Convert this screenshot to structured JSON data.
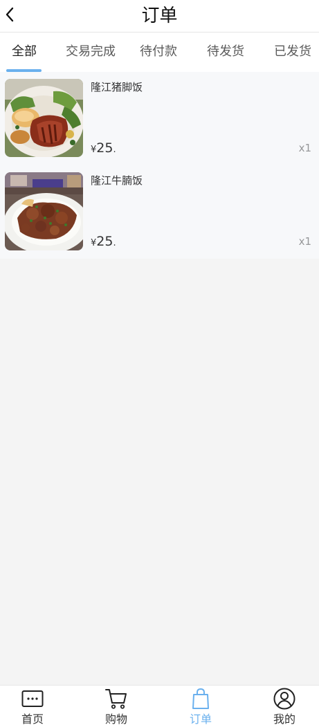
{
  "header": {
    "title": "订单"
  },
  "tabs": [
    {
      "label": "全部",
      "active": true
    },
    {
      "label": "交易完成",
      "active": false
    },
    {
      "label": "待付款",
      "active": false
    },
    {
      "label": "待发货",
      "active": false
    },
    {
      "label": "已发货",
      "active": false
    }
  ],
  "orders": [
    {
      "name": "隆江猪脚饭",
      "currency": "¥",
      "price": "25",
      "price_suffix": ".",
      "quantity": "x1",
      "image": "pork-knuckle-rice-photo"
    },
    {
      "name": "隆江牛腩饭",
      "currency": "¥",
      "price": "25",
      "price_suffix": ".",
      "quantity": "x1",
      "image": "beef-brisket-rice-photo"
    }
  ],
  "bottom_nav": [
    {
      "label": "首页",
      "icon": "home-icon",
      "active": false
    },
    {
      "label": "购物",
      "icon": "cart-icon",
      "active": false
    },
    {
      "label": "订单",
      "icon": "bag-icon",
      "active": true
    },
    {
      "label": "我的",
      "icon": "user-icon",
      "active": false
    }
  ],
  "colors": {
    "accent": "#6ab0ee",
    "background": "#f4f4f4",
    "list_background": "#f7f8fa",
    "text": "#323233",
    "muted": "#969799"
  }
}
